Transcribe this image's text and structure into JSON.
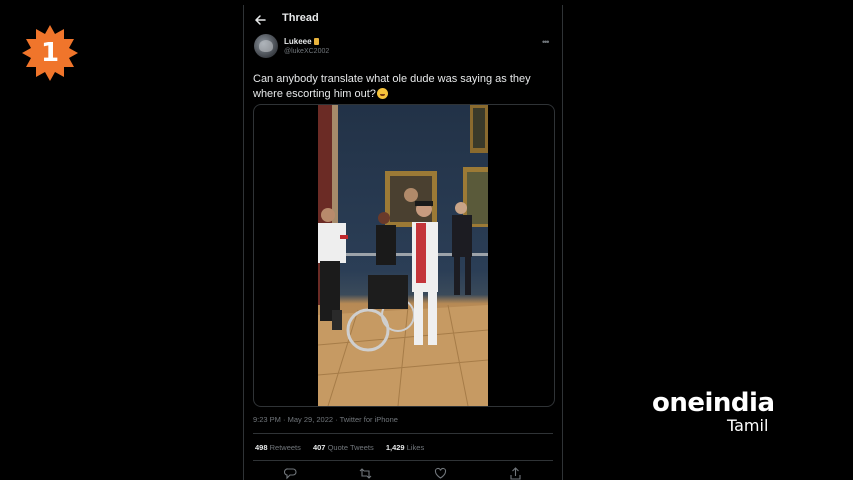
{
  "badge": {
    "number": "1",
    "color": "#f0752b"
  },
  "thread": {
    "header_title": "Thread",
    "author": {
      "display_name": "Lukeee",
      "handle": "@lukeXC2002",
      "emoji_name": "beer-icon"
    },
    "tweet_text": "Can anybody translate what ole dude was saying as they where escorting him out?",
    "tweet_emoji": "laughing-emoji",
    "timestamp": "9:23 PM · May 29, 2022 · Twitter for iPhone",
    "stats": {
      "retweets_count": "498",
      "retweets_label": "Retweets",
      "quotes_count": "407",
      "quotes_label": "Quote Tweets",
      "likes_count": "1,429",
      "likes_label": "Likes"
    },
    "actions": [
      "reply-icon",
      "retweet-icon",
      "like-icon",
      "share-icon"
    ]
  },
  "watermark": {
    "brand": "oneindia",
    "sub": "Tamil"
  }
}
